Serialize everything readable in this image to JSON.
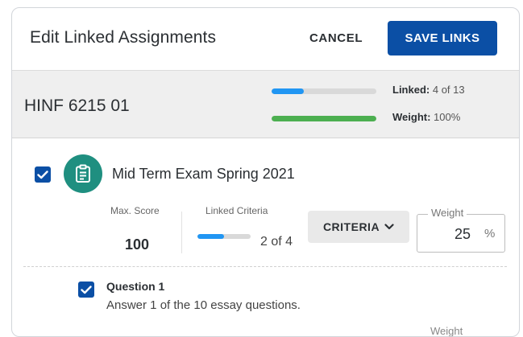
{
  "dialog": {
    "title": "Edit Linked Assignments",
    "cancel_label": "CANCEL",
    "save_label": "SAVE LINKS"
  },
  "course": {
    "name": "HINF 6215 01",
    "linked_label": "Linked:",
    "linked_value": "4 of 13",
    "linked_fraction": 0.31,
    "weight_label": "Weight:",
    "weight_value": "100%",
    "weight_fraction": 1.0
  },
  "assignment": {
    "checked": true,
    "icon": "clipboard-icon",
    "title": "Mid Term Exam Spring 2021",
    "max_score_label": "Max. Score",
    "max_score": "100",
    "linked_criteria_label": "Linked Criteria",
    "linked_criteria_value": "2 of 4",
    "linked_criteria_fraction": 0.5,
    "criteria_button": "CRITERIA",
    "weight_label": "Weight",
    "weight_value": "25",
    "weight_unit": "%"
  },
  "question": {
    "checked": true,
    "title": "Question 1",
    "description": "Answer 1 of the 10 essay questions.",
    "weight_label": "Weight"
  },
  "colors": {
    "primary": "#0b4fa5",
    "linked_bar": "#2196f3",
    "weight_bar": "#4caf50",
    "assignment_icon_bg": "#1f8f80"
  }
}
